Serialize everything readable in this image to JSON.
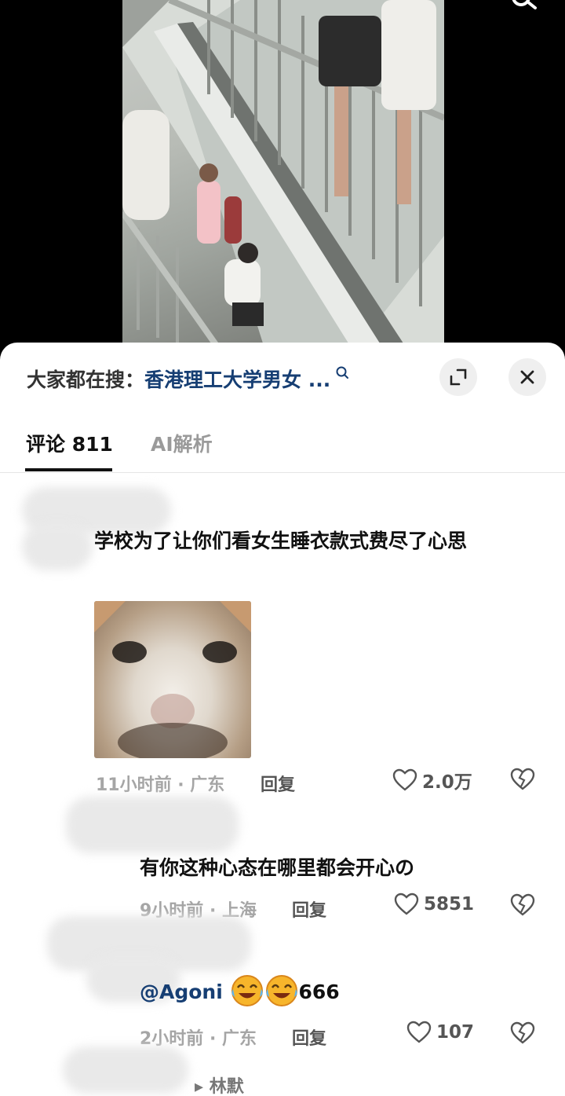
{
  "video": {
    "description": "stairwell"
  },
  "panel": {
    "search_prefix": "大家都在搜：",
    "search_term": "香港理工大学男女 ..."
  },
  "tabs": [
    {
      "label": "评论 811"
    },
    {
      "label": "AI解析"
    }
  ],
  "comments": [
    {
      "text": "学校为了让你们看女生睡衣款式费尽了心思",
      "time": "11小时前 · 广东",
      "reply": "回复",
      "likes": "2.0万",
      "has_image": true
    },
    {
      "text": "有你这种心态在哪里都会开心の",
      "time": "9小时前 · 上海",
      "reply": "回复",
      "likes": "5851"
    },
    {
      "mention": "@Agoni",
      "text_after": "666",
      "time": "2小时前 · 广东",
      "reply": "回复",
      "likes": "107"
    }
  ],
  "expand_replies": "▸ 林默",
  "colors": {
    "accent": "#163e73",
    "muted": "#a5a5a5"
  }
}
